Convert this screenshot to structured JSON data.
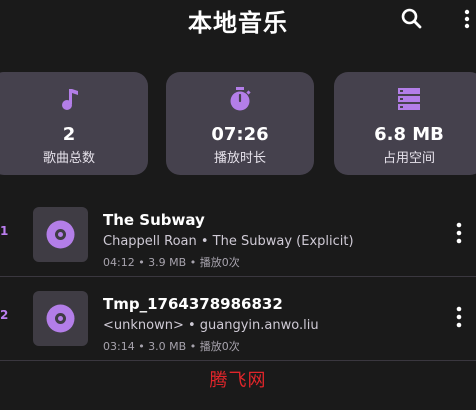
{
  "header": {
    "title": "本地音乐",
    "search_icon": "search-icon",
    "more_icon": "more-vert-icon"
  },
  "stats": [
    {
      "icon": "music-note-icon",
      "value": "2",
      "label": "歌曲总数"
    },
    {
      "icon": "timer-icon",
      "value": "07:26",
      "label": "播放时长"
    },
    {
      "icon": "storage-icon",
      "value": "6.8 MB",
      "label": "占用空间"
    }
  ],
  "songs": [
    {
      "index": "1",
      "title": "The Subway",
      "subtitle": "Chappell Roan • The Subway (Explicit)",
      "meta": "04:12 • 3.9 MB • 播放0次"
    },
    {
      "index": "2",
      "title": "Tmp_1764378986832",
      "subtitle": "<unknown> • guangyin.anwo.liu",
      "meta": "03:14 • 3.0 MB • 播放0次"
    }
  ],
  "watermark": "腾飞网",
  "colors": {
    "background": "#1a1a1a",
    "card": "#45414d",
    "accent": "#b37ee8",
    "index": "#bb7ef0",
    "watermark": "#e0252a"
  }
}
